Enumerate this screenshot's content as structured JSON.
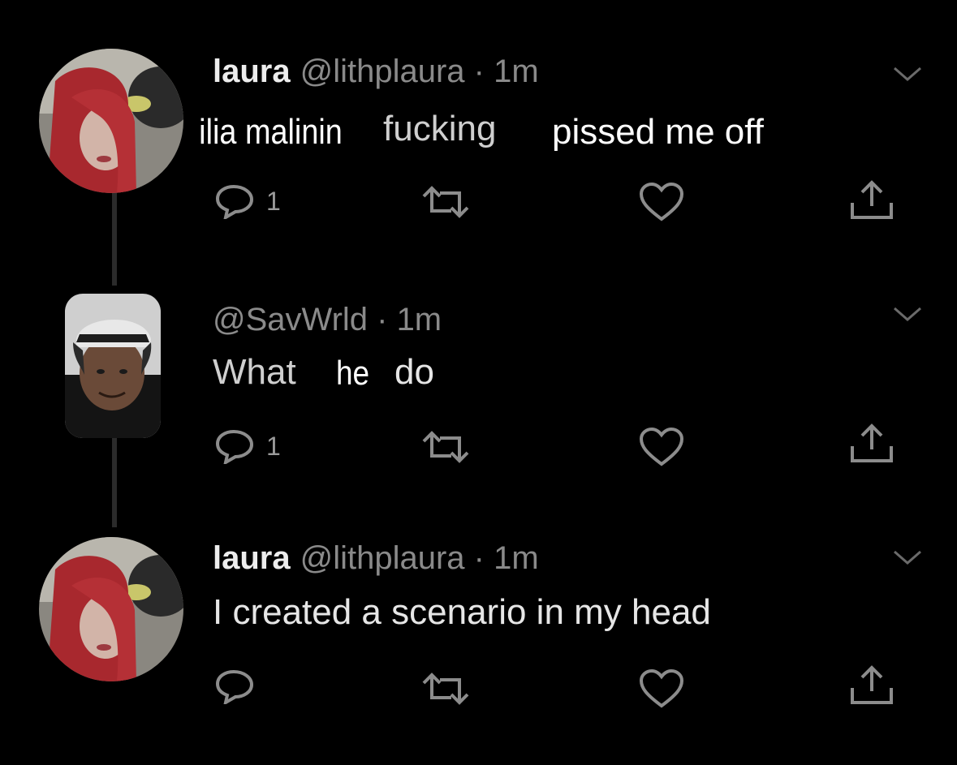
{
  "tweets": [
    {
      "name": "laura",
      "meta": "@lithplaura · 1m",
      "body_prefix": "ilia malinin",
      "body_word": "fucking",
      "body_suffix": "pissed me off",
      "reply_count": "1"
    },
    {
      "meta": "@SavWrld · 1m",
      "body_a": "What",
      "body_b": "he",
      "body_c": "do",
      "reply_count": "1"
    },
    {
      "name": "laura",
      "meta": "@lithplaura · 1m",
      "body": "I created a scenario in my head"
    }
  ],
  "icons": {
    "reply": "reply-icon",
    "retweet": "retweet-icon",
    "like": "heart-icon",
    "share": "share-icon",
    "more": "chevron-down-icon"
  },
  "colors": {
    "background": "#000000",
    "text": "#e6e6e6",
    "muted": "#8a8a8a",
    "overlay_text": "#ffffff"
  }
}
